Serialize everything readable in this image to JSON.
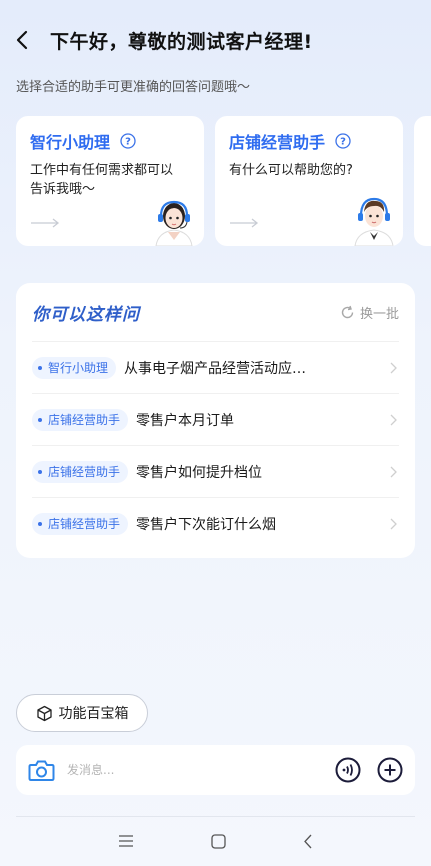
{
  "header": {
    "greeting": "下午好，尊敬的测试客户经理!"
  },
  "subtitle": "选择合适的助手可更准确的回答问题哦～",
  "assistants": [
    {
      "title": "智行小助理",
      "desc": "工作中有任何需求都可以告诉我哦～"
    },
    {
      "title": "店铺经营助手",
      "desc": "有什么可以帮助您的?"
    }
  ],
  "suggest": {
    "title": "你可以这样问",
    "refresh_label": "换一批",
    "questions": [
      {
        "tag": "智行小助理",
        "text": "从事电子烟产品经营活动应…"
      },
      {
        "tag": "店铺经营助手",
        "text": "零售户本月订单"
      },
      {
        "tag": "店铺经营助手",
        "text": "零售户如何提升档位"
      },
      {
        "tag": "店铺经营助手",
        "text": "零售户下次能订什么烟"
      }
    ]
  },
  "toolbox": {
    "label": "功能百宝箱"
  },
  "input": {
    "placeholder": "发消息..."
  },
  "colors": {
    "accent": "#2f6cf0",
    "title_blue": "#2f5fc9",
    "background": "#e8eefb"
  },
  "icons": [
    "back-icon",
    "help-icon",
    "arrow-right-icon",
    "refresh-icon",
    "chevron-right-icon",
    "cube-icon",
    "camera-icon",
    "voice-icon",
    "plus-icon",
    "menu-icon",
    "home-icon",
    "back-nav-icon"
  ]
}
